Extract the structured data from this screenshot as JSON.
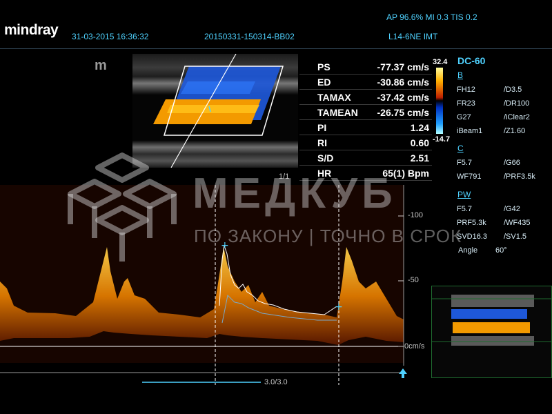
{
  "header": {
    "brand": "mindray",
    "datetime": "31-03-2015 16:36:32",
    "exam_id": "20150331-150314-BB02",
    "power_info": "AP 96.6%  MI 0.3  TIS 0.2",
    "probe": "L14-6NE  IMT"
  },
  "measurements": [
    {
      "label": "PS",
      "value": "-77.37 cm/s"
    },
    {
      "label": "ED",
      "value": "-30.86 cm/s"
    },
    {
      "label": "TAMAX",
      "value": "-37.42 cm/s"
    },
    {
      "label": "TAMEAN",
      "value": "-26.75 cm/s"
    },
    {
      "label": "PI",
      "value": "1.24"
    },
    {
      "label": "RI",
      "value": "0.60"
    },
    {
      "label": "S/D",
      "value": "2.51"
    },
    {
      "label": "HR",
      "value": "65(1) Bpm"
    }
  ],
  "color_bar": {
    "max": "32.4",
    "min": "-14.7"
  },
  "params": {
    "title": "DC-60",
    "b_section": "B",
    "b": [
      [
        "FH12",
        "/D3.5"
      ],
      [
        "FR23",
        "/DR100"
      ],
      [
        "G27",
        "/iClear2"
      ],
      [
        "iBeam1",
        "/Z1.60"
      ]
    ],
    "c_section": "C",
    "c": [
      [
        "F5.7",
        "/G66"
      ],
      [
        "WF791",
        "/PRF3.5k"
      ]
    ],
    "pw_section": "PW",
    "pw": [
      [
        "F5.7",
        "/G42"
      ],
      [
        "PRF5.3k",
        "/WF435"
      ],
      [
        "SVD16.3",
        "/SV1.5"
      ]
    ],
    "angle_label": "Angle",
    "angle_value": "60°"
  },
  "scale": {
    "top": "-100",
    "mid": "-50",
    "zero": "0cm/s"
  },
  "markers": {
    "bmode_range": "1/1",
    "sweep": "3.0/3.0"
  },
  "logo_mark": "m",
  "watermark": {
    "title": "МЕДКУБ",
    "subtitle": "ПО ЗАКОНУ | ТОЧНО В СРОК"
  },
  "colors": {
    "accent": "#4fd2ff",
    "spectrum": "#ffb000",
    "trace": "#ffffff"
  }
}
